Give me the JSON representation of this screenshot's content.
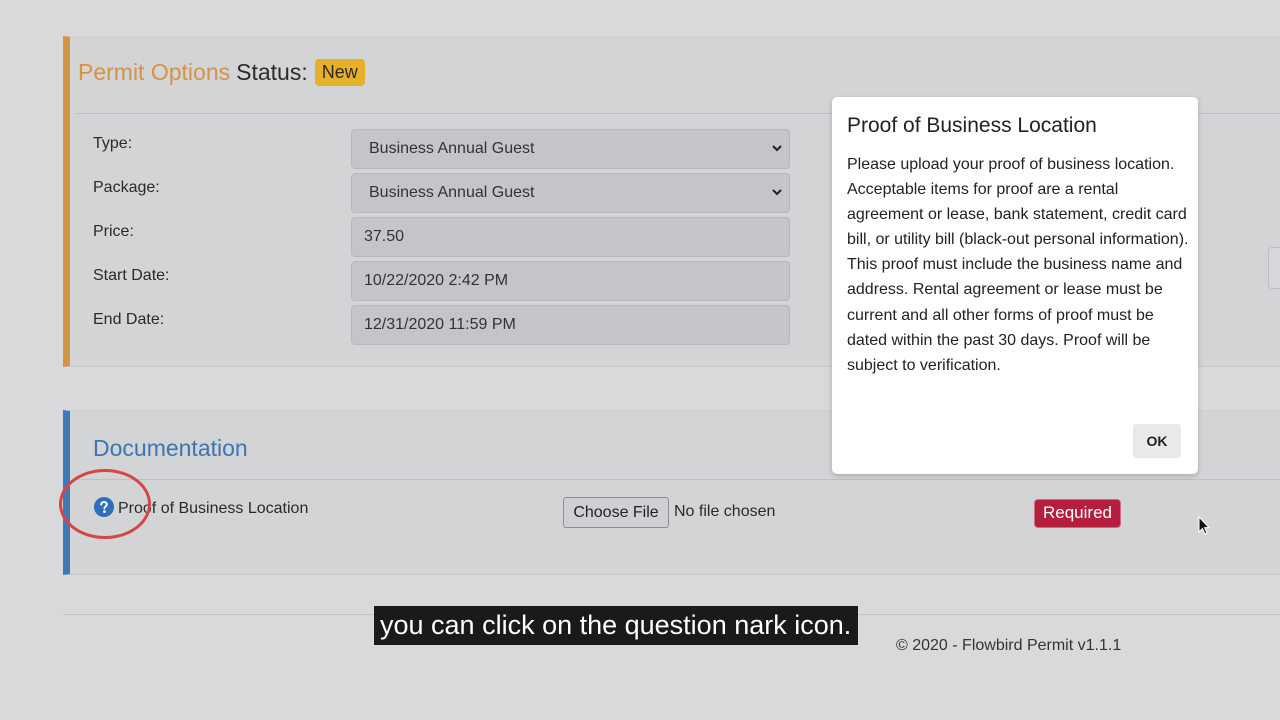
{
  "permit_options": {
    "title": "Permit Options",
    "status_label": "Status:",
    "status_badge": "New",
    "fields": [
      {
        "label": "Type:",
        "value": "Business Annual Guest",
        "kind": "select"
      },
      {
        "label": "Package:",
        "value": "Business Annual Guest",
        "kind": "select"
      },
      {
        "label": "Price:",
        "value": "37.50",
        "kind": "readonly"
      },
      {
        "label": "Start Date:",
        "value": "10/22/2020 2:42 PM",
        "kind": "readonly"
      },
      {
        "label": "End Date:",
        "value": "12/31/2020 11:59 PM",
        "kind": "readonly"
      }
    ]
  },
  "documentation": {
    "title": "Documentation",
    "item_label": "Proof of Business Location",
    "help_icon": "question-circle-icon",
    "choose_file_label": "Choose File",
    "no_file_text": "No file chosen",
    "required_badge": "Required"
  },
  "modal": {
    "title": "Proof of Business Location",
    "body": "Please upload your proof of business location. Acceptable items for proof are a rental agreement or lease, bank statement, credit card bill, or utility bill (black-out personal information). This proof must include the business name and address. Rental agreement or lease must be current and all other forms of proof must be dated within the past 30 days. Proof will be subject to verification.",
    "ok_label": "OK"
  },
  "footer": {
    "copyright": "© 2020 - Flowbird Permit v1.1.1"
  },
  "subtitle": "you can click on the question nark icon.",
  "colors": {
    "permit_accent": "#d69343",
    "doc_accent": "#3d7ab5",
    "status_badge": "#e6b02a",
    "required_badge": "#b51f3d",
    "highlight_circle": "#d74545"
  }
}
